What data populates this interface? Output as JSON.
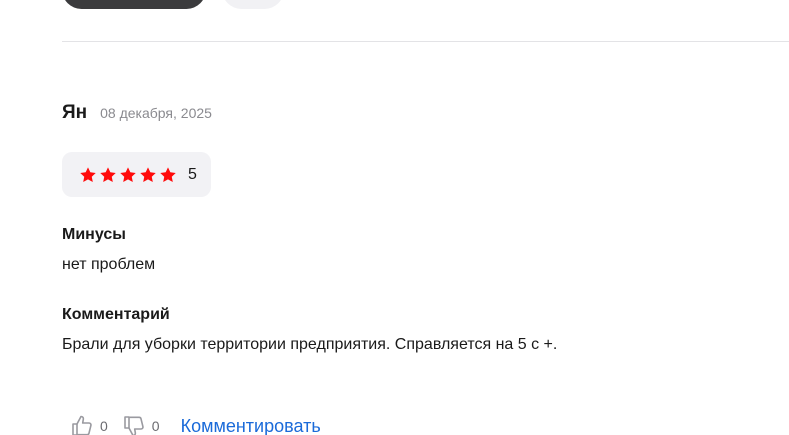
{
  "review": {
    "author": "Ян",
    "date": "08 декабря, 2025",
    "rating": {
      "stars": 5,
      "value": "5",
      "star_color": "#ff0a0a"
    },
    "cons_title": "Минусы",
    "cons_text": "нет проблем",
    "comment_title": "Комментарий",
    "comment_text": "Брали для уборки территории предприятия. Справляется на 5 с +."
  },
  "actions": {
    "like_icon": "thumbs-up-icon",
    "like_count": "0",
    "dislike_icon": "thumbs-down-icon",
    "dislike_count": "0",
    "comment_link": "Комментировать",
    "link_color": "#1a6ad9"
  }
}
